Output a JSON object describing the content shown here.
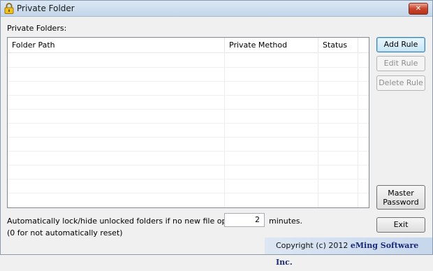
{
  "window": {
    "title": "Private Folder",
    "close_symbol": "✕",
    "icon": "lock-icon"
  },
  "main": {
    "folders_label": "Private Folders:",
    "columns": [
      "Folder Path",
      "Private Method",
      "Status"
    ],
    "rows": []
  },
  "buttons": {
    "add_rule": "Add Rule",
    "edit_rule": "Edit Rule",
    "delete_rule": "Delete Rule",
    "master_password_line1": "Master",
    "master_password_line2": "Password",
    "exit": "Exit"
  },
  "auto_lock": {
    "text": "Automatically lock/hide unlocked folders if no new file openned for",
    "value": "2",
    "unit": "minutes.",
    "note": "(0 for not automatically reset)"
  },
  "footer": {
    "copyright": "Copyright (c) 2012",
    "company": "eMing Software Inc."
  },
  "colors": {
    "accent": "#3c7fb1",
    "footer_text": "#1a2a7a",
    "close": "#c8452d"
  }
}
